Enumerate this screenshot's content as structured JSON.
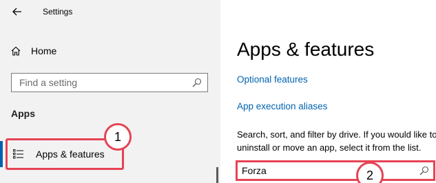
{
  "window": {
    "title": "Settings"
  },
  "sidebar": {
    "home_label": "Home",
    "search_placeholder": "Find a setting",
    "section_label": "Apps",
    "selected_item_label": "Apps & features"
  },
  "main": {
    "title": "Apps & features",
    "links": [
      "Optional features",
      "App execution aliases"
    ],
    "description": "Search, sort, and filter by drive. If you would like to uninstall or move an app, select it from the list.",
    "search_value": "Forza"
  },
  "annotations": {
    "badge_1": "1",
    "badge_2": "2"
  },
  "colors": {
    "accent": "#0063b1",
    "highlight": "#e54354",
    "sidebar_bg": "#f2f2f2"
  },
  "icons": [
    "back-arrow-icon",
    "home-icon",
    "search-icon",
    "list-icon"
  ]
}
